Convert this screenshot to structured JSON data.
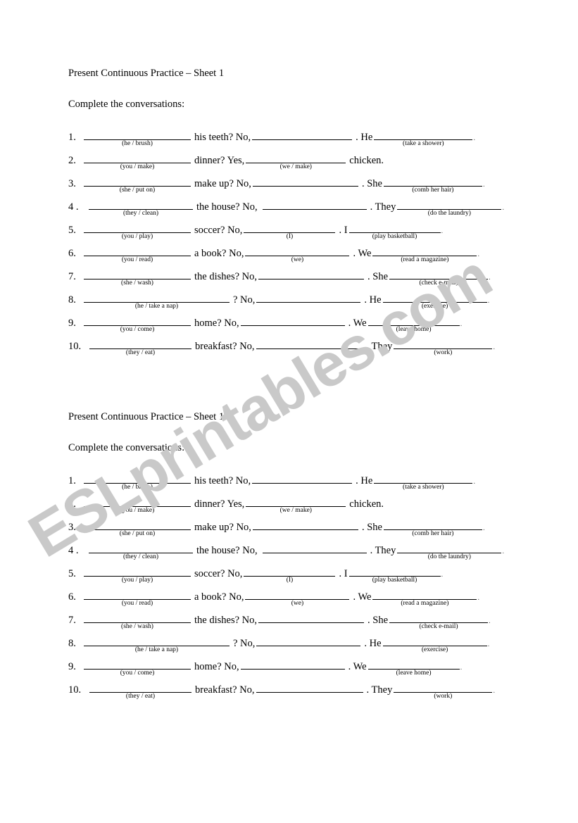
{
  "document": {
    "watermark": "ESLprintables.com",
    "watermark_color": "#c9c9c9",
    "page_background": "#ffffff",
    "text_color": "#000000"
  },
  "sheet": {
    "title": "Present Continuous Practice – Sheet 1",
    "instruction": "Complete the conversations:",
    "items": [
      {
        "number": "1.",
        "blank1_hint": "(he / brush)",
        "text_after_blank1": "his teeth? No,",
        "blank2_hint": "",
        "text_after_blank2": ". He",
        "blank3_hint": "(take a shower)",
        "text_end": "."
      },
      {
        "number": "2.",
        "blank1_hint": "(you / make)",
        "text_after_blank1": "dinner? Yes,",
        "blank2_hint": "(we / make)",
        "text_after_blank2": "chicken.",
        "blank3_hint": "",
        "text_end": ""
      },
      {
        "number": "3.",
        "blank1_hint": "(she / put on)",
        "text_after_blank1": "make up? No,",
        "blank2_hint": "",
        "text_after_blank2": ". She",
        "blank3_hint": "(comb her hair)",
        "text_end": "."
      },
      {
        "number": "4 .",
        "blank1_hint": "(they / clean)",
        "text_after_blank1": "the house? No,",
        "blank2_hint": "",
        "text_after_blank2": ". They",
        "blank3_hint": "(do the laundry)",
        "text_end": "."
      },
      {
        "number": "5.",
        "blank1_hint": "(you / play)",
        "text_after_blank1": "soccer? No,",
        "blank2_hint": "(I)",
        "text_after_blank2": ". I",
        "blank3_hint": "(play basketball)",
        "text_end": "."
      },
      {
        "number": "6.",
        "blank1_hint": "(you / read)",
        "text_after_blank1": "a book? No,",
        "blank2_hint": "(we)",
        "text_after_blank2": ". We",
        "blank3_hint": "(read a magazine)",
        "text_end": "."
      },
      {
        "number": "7.",
        "blank1_hint": "(she / wash)",
        "text_after_blank1": "the dishes? No,",
        "blank2_hint": "",
        "text_after_blank2": ". She",
        "blank3_hint": "(check e-mail)",
        "text_end": "."
      },
      {
        "number": "8.",
        "blank1_hint": "(he / take a nap)",
        "text_after_blank1": "? No,",
        "blank2_hint": "",
        "text_after_blank2": ". He",
        "blank3_hint": "(exercise)",
        "text_end": "."
      },
      {
        "number": "9.",
        "blank1_hint": "(you / come)",
        "text_after_blank1": "home? No,",
        "blank2_hint": "",
        "text_after_blank2": ". We",
        "blank3_hint": "(leave home)",
        "text_end": "."
      },
      {
        "number": "10.",
        "blank1_hint": "(they / eat)",
        "text_after_blank1": "breakfast? No,",
        "blank2_hint": "",
        "text_after_blank2": ". They",
        "blank3_hint": "(work)",
        "text_end": "."
      }
    ]
  }
}
